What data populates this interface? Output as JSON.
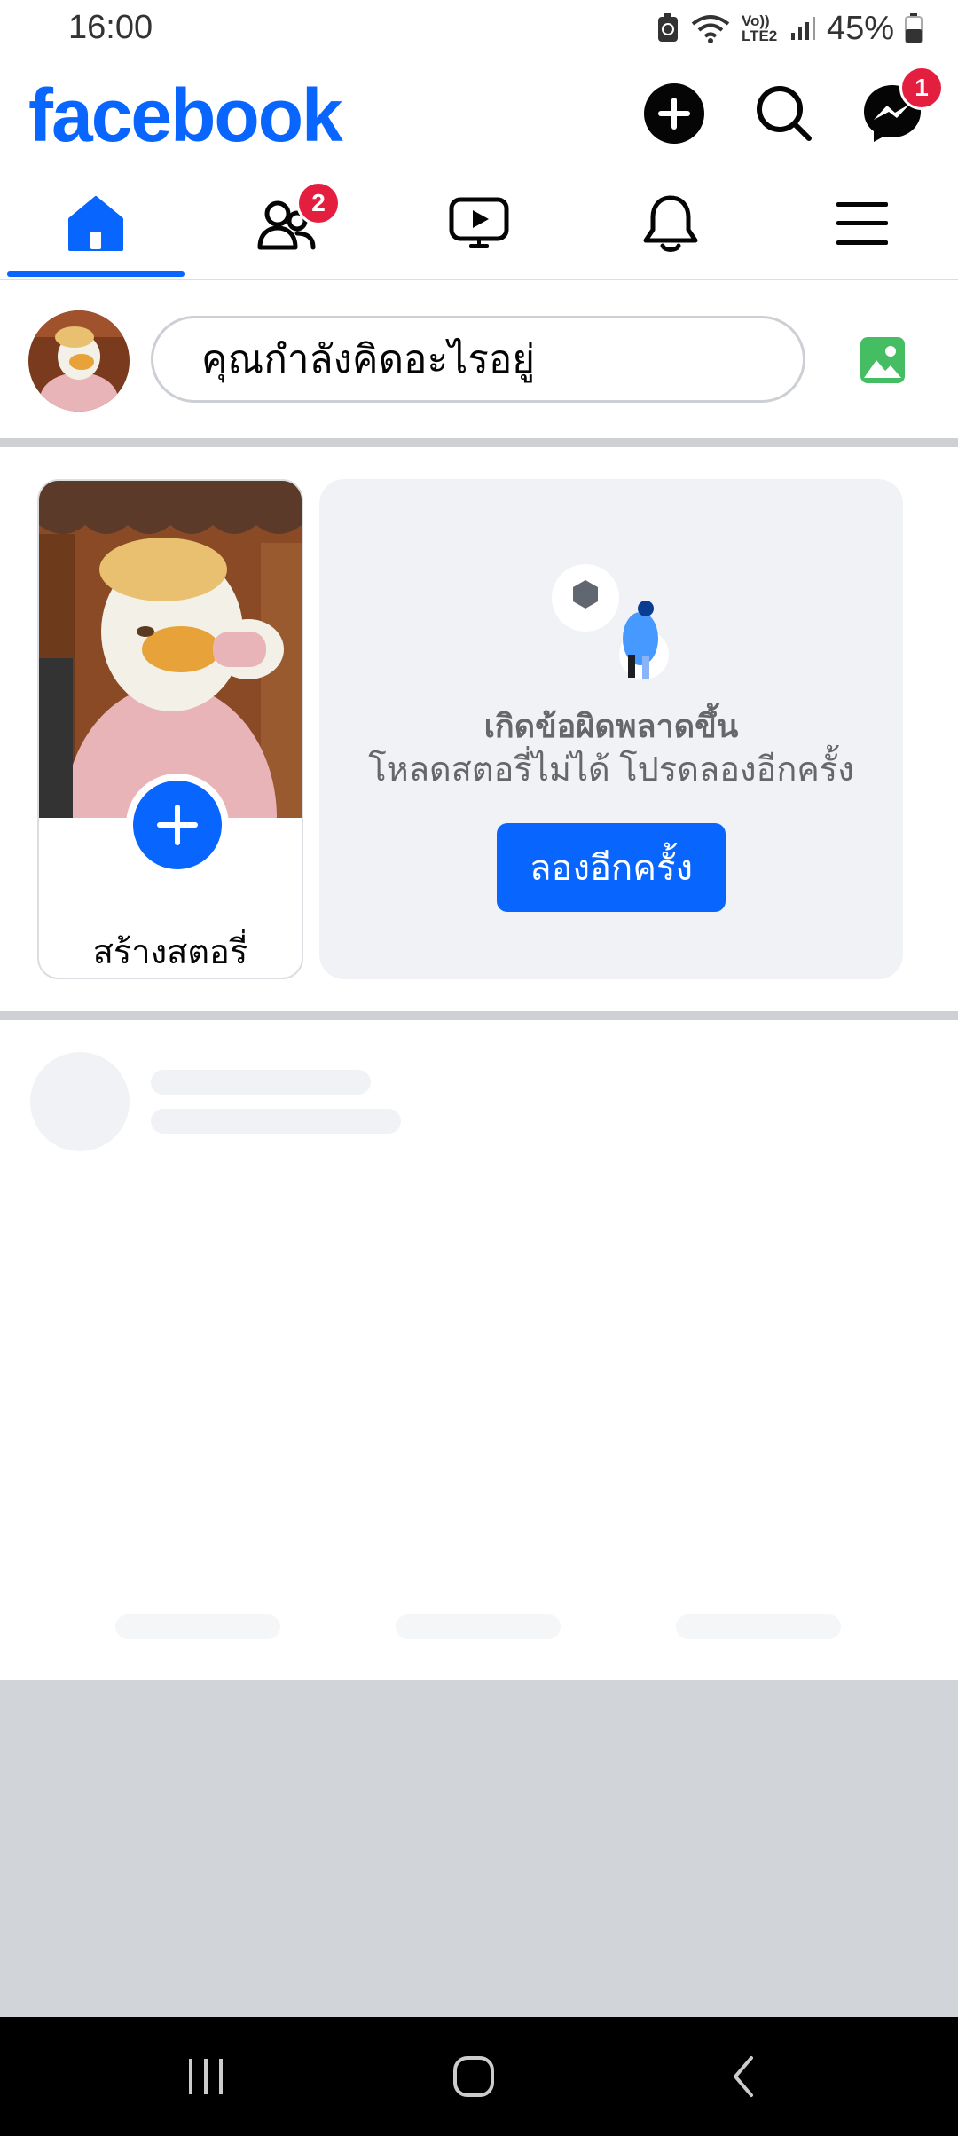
{
  "status": {
    "time": "16:00",
    "battery_text": "45%",
    "network_label": "Vo)) LTE2"
  },
  "header": {
    "logo": "facebook",
    "messenger_badge": "1"
  },
  "tabs": [
    {
      "name": "home",
      "active": true
    },
    {
      "name": "friends",
      "badge": "2"
    },
    {
      "name": "video"
    },
    {
      "name": "notifications"
    },
    {
      "name": "menu"
    }
  ],
  "composer": {
    "placeholder": "คุณกำลังคิดอะไรอยู่"
  },
  "stories": {
    "create_label": "สร้างสตอรี่",
    "error_title": "เกิดข้อผิดพลาดขึ้น",
    "error_subtitle": "โหลดสตอรี่ไม่ได้ โปรดลองอีกครั้ง",
    "retry_label": "ลองอีกครั้ง"
  },
  "colors": {
    "brand": "#0866ff",
    "badge": "#e41e3f",
    "photo_icon": "#45bd62"
  },
  "icons": [
    "add-icon",
    "search-icon",
    "messenger-icon",
    "home-icon",
    "friends-icon",
    "video-icon",
    "bell-icon",
    "menu-icon",
    "photo-icon",
    "plus-icon"
  ]
}
